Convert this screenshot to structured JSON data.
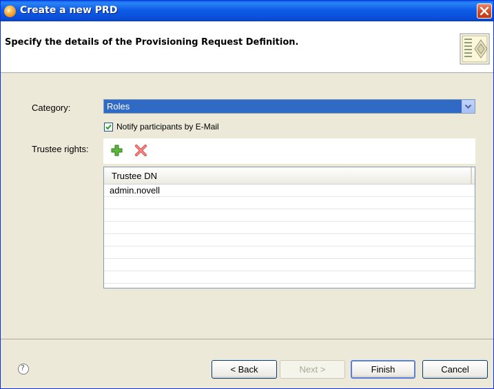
{
  "window": {
    "title": "Create a new PRD",
    "header_title": "Specify the details of the Provisioning Request Definition."
  },
  "form": {
    "category_label": "Category:",
    "category_value": "Roles",
    "notify_label": "Notify participants by E-Mail",
    "notify_checked": true,
    "trustee_label": "Trustee rights:"
  },
  "table": {
    "column_header": "Trustee DN",
    "rows": [
      "admin.novell",
      "",
      "",
      "",
      "",
      "",
      "",
      ""
    ]
  },
  "buttons": {
    "back": "< Back",
    "next": "Next >",
    "finish": "Finish",
    "cancel": "Cancel"
  },
  "icons": {
    "title": "app-icon",
    "close": "close-icon",
    "header": "wizard-banner-icon",
    "add": "add-icon",
    "remove": "remove-icon",
    "help": "help-icon",
    "dropdown": "chevron-down-icon"
  }
}
